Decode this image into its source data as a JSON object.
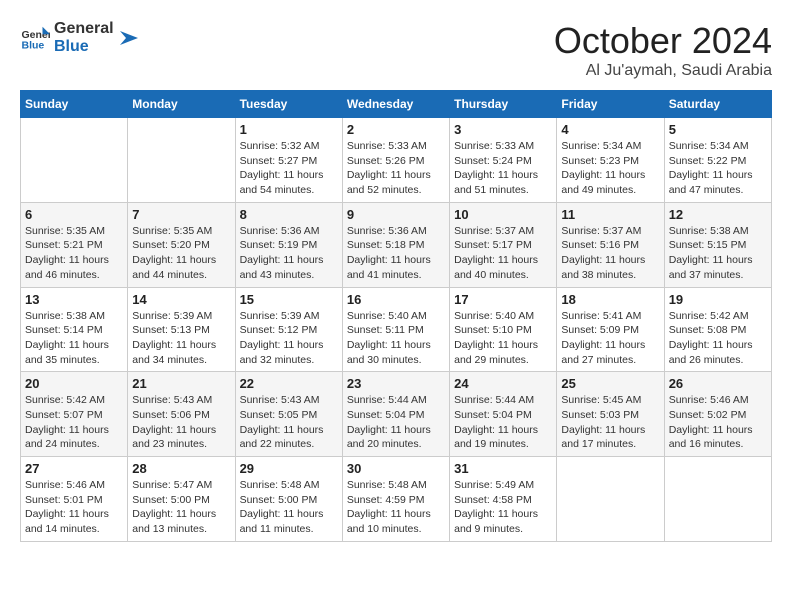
{
  "logo": {
    "text_general": "General",
    "text_blue": "Blue"
  },
  "title": "October 2024",
  "location": "Al Ju'aymah, Saudi Arabia",
  "weekdays": [
    "Sunday",
    "Monday",
    "Tuesday",
    "Wednesday",
    "Thursday",
    "Friday",
    "Saturday"
  ],
  "weeks": [
    [
      {
        "day": "",
        "info": ""
      },
      {
        "day": "",
        "info": ""
      },
      {
        "day": "1",
        "info": "Sunrise: 5:32 AM\nSunset: 5:27 PM\nDaylight: 11 hours and 54 minutes."
      },
      {
        "day": "2",
        "info": "Sunrise: 5:33 AM\nSunset: 5:26 PM\nDaylight: 11 hours and 52 minutes."
      },
      {
        "day": "3",
        "info": "Sunrise: 5:33 AM\nSunset: 5:24 PM\nDaylight: 11 hours and 51 minutes."
      },
      {
        "day": "4",
        "info": "Sunrise: 5:34 AM\nSunset: 5:23 PM\nDaylight: 11 hours and 49 minutes."
      },
      {
        "day": "5",
        "info": "Sunrise: 5:34 AM\nSunset: 5:22 PM\nDaylight: 11 hours and 47 minutes."
      }
    ],
    [
      {
        "day": "6",
        "info": "Sunrise: 5:35 AM\nSunset: 5:21 PM\nDaylight: 11 hours and 46 minutes."
      },
      {
        "day": "7",
        "info": "Sunrise: 5:35 AM\nSunset: 5:20 PM\nDaylight: 11 hours and 44 minutes."
      },
      {
        "day": "8",
        "info": "Sunrise: 5:36 AM\nSunset: 5:19 PM\nDaylight: 11 hours and 43 minutes."
      },
      {
        "day": "9",
        "info": "Sunrise: 5:36 AM\nSunset: 5:18 PM\nDaylight: 11 hours and 41 minutes."
      },
      {
        "day": "10",
        "info": "Sunrise: 5:37 AM\nSunset: 5:17 PM\nDaylight: 11 hours and 40 minutes."
      },
      {
        "day": "11",
        "info": "Sunrise: 5:37 AM\nSunset: 5:16 PM\nDaylight: 11 hours and 38 minutes."
      },
      {
        "day": "12",
        "info": "Sunrise: 5:38 AM\nSunset: 5:15 PM\nDaylight: 11 hours and 37 minutes."
      }
    ],
    [
      {
        "day": "13",
        "info": "Sunrise: 5:38 AM\nSunset: 5:14 PM\nDaylight: 11 hours and 35 minutes."
      },
      {
        "day": "14",
        "info": "Sunrise: 5:39 AM\nSunset: 5:13 PM\nDaylight: 11 hours and 34 minutes."
      },
      {
        "day": "15",
        "info": "Sunrise: 5:39 AM\nSunset: 5:12 PM\nDaylight: 11 hours and 32 minutes."
      },
      {
        "day": "16",
        "info": "Sunrise: 5:40 AM\nSunset: 5:11 PM\nDaylight: 11 hours and 30 minutes."
      },
      {
        "day": "17",
        "info": "Sunrise: 5:40 AM\nSunset: 5:10 PM\nDaylight: 11 hours and 29 minutes."
      },
      {
        "day": "18",
        "info": "Sunrise: 5:41 AM\nSunset: 5:09 PM\nDaylight: 11 hours and 27 minutes."
      },
      {
        "day": "19",
        "info": "Sunrise: 5:42 AM\nSunset: 5:08 PM\nDaylight: 11 hours and 26 minutes."
      }
    ],
    [
      {
        "day": "20",
        "info": "Sunrise: 5:42 AM\nSunset: 5:07 PM\nDaylight: 11 hours and 24 minutes."
      },
      {
        "day": "21",
        "info": "Sunrise: 5:43 AM\nSunset: 5:06 PM\nDaylight: 11 hours and 23 minutes."
      },
      {
        "day": "22",
        "info": "Sunrise: 5:43 AM\nSunset: 5:05 PM\nDaylight: 11 hours and 22 minutes."
      },
      {
        "day": "23",
        "info": "Sunrise: 5:44 AM\nSunset: 5:04 PM\nDaylight: 11 hours and 20 minutes."
      },
      {
        "day": "24",
        "info": "Sunrise: 5:44 AM\nSunset: 5:04 PM\nDaylight: 11 hours and 19 minutes."
      },
      {
        "day": "25",
        "info": "Sunrise: 5:45 AM\nSunset: 5:03 PM\nDaylight: 11 hours and 17 minutes."
      },
      {
        "day": "26",
        "info": "Sunrise: 5:46 AM\nSunset: 5:02 PM\nDaylight: 11 hours and 16 minutes."
      }
    ],
    [
      {
        "day": "27",
        "info": "Sunrise: 5:46 AM\nSunset: 5:01 PM\nDaylight: 11 hours and 14 minutes."
      },
      {
        "day": "28",
        "info": "Sunrise: 5:47 AM\nSunset: 5:00 PM\nDaylight: 11 hours and 13 minutes."
      },
      {
        "day": "29",
        "info": "Sunrise: 5:48 AM\nSunset: 5:00 PM\nDaylight: 11 hours and 11 minutes."
      },
      {
        "day": "30",
        "info": "Sunrise: 5:48 AM\nSunset: 4:59 PM\nDaylight: 11 hours and 10 minutes."
      },
      {
        "day": "31",
        "info": "Sunrise: 5:49 AM\nSunset: 4:58 PM\nDaylight: 11 hours and 9 minutes."
      },
      {
        "day": "",
        "info": ""
      },
      {
        "day": "",
        "info": ""
      }
    ]
  ]
}
